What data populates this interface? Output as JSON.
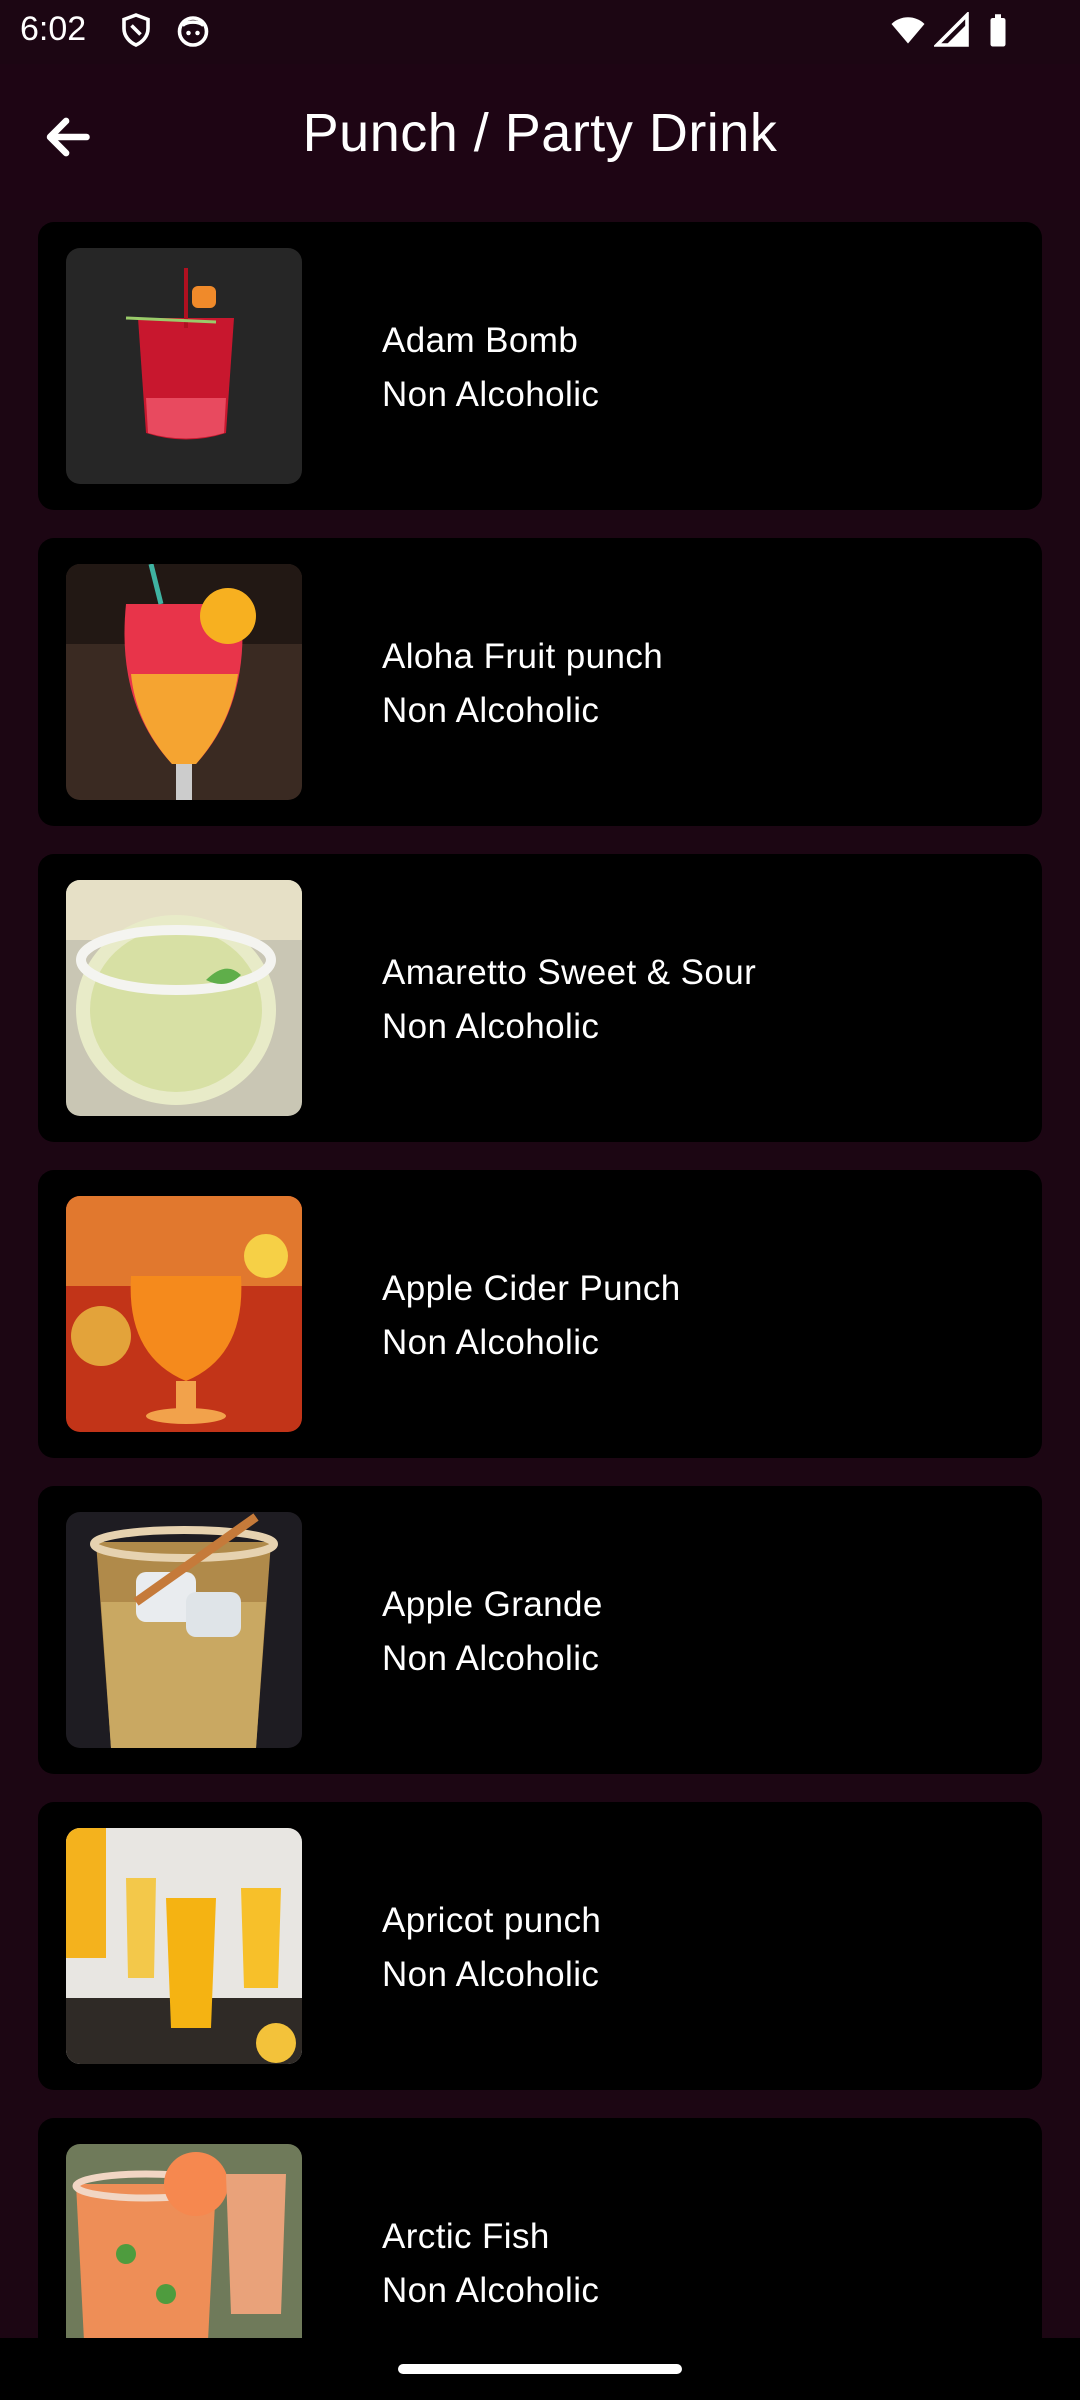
{
  "status_bar": {
    "time": "6:02",
    "icons_left": [
      "shield-icon",
      "face-icon"
    ],
    "icons_right": [
      "wifi-icon",
      "signal-icon",
      "battery-icon"
    ]
  },
  "app_bar": {
    "title": "Punch / Party Drink",
    "back_icon": "arrow-left-icon"
  },
  "drinks": [
    {
      "name": "Adam Bomb",
      "category": "Non Alcoholic"
    },
    {
      "name": "Aloha Fruit punch",
      "category": "Non Alcoholic"
    },
    {
      "name": "Amaretto Sweet & Sour",
      "category": "Non Alcoholic"
    },
    {
      "name": "Apple Cider Punch",
      "category": "Non Alcoholic"
    },
    {
      "name": "Apple Grande",
      "category": "Non Alcoholic"
    },
    {
      "name": "Apricot punch",
      "category": "Non Alcoholic"
    },
    {
      "name": "Arctic Fish",
      "category": "Non Alcoholic"
    }
  ],
  "colors": {
    "background": "#1c0613",
    "card": "#000000",
    "text": "#ffffff"
  }
}
